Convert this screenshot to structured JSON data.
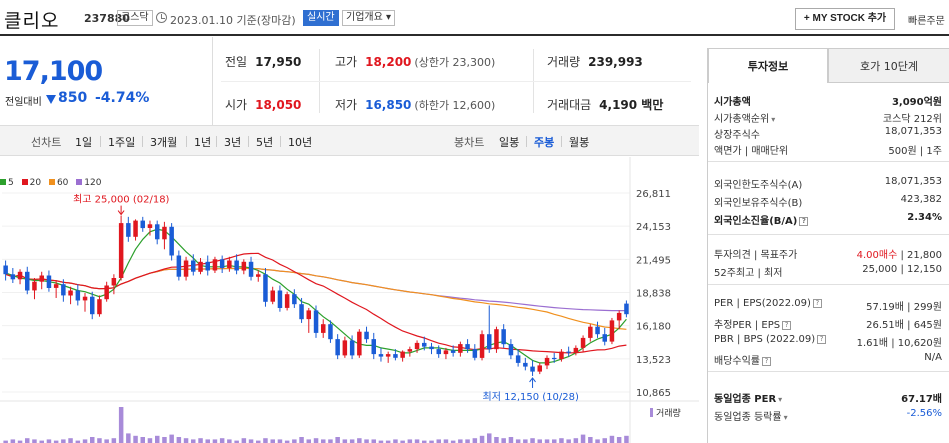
{
  "header": {
    "stock_name": "클리오",
    "stock_code": "237880",
    "market": "코스닥",
    "date_text": "2023.01.10 기준(장마감)",
    "live_label": "실시간",
    "corp_label": "기업개요",
    "corp_caret": "▾",
    "mystock_label": "+ MY STOCK 추가",
    "quick_label": "빠른주문"
  },
  "price": {
    "current": "17,100",
    "compare_label": "전일대비",
    "change": "850",
    "change_rate": "-4.74%"
  },
  "quote": {
    "prev_label": "전일",
    "prev": "17,950",
    "high_label": "고가",
    "high": "18,200",
    "upper_limit": "(상한가 23,300)",
    "volume_label": "거래량",
    "volume": "239,993",
    "open_label": "시가",
    "open": "18,050",
    "low_label": "저가",
    "low": "16,850",
    "lower_limit": "(하한가 12,600)",
    "amount_label": "거래대금",
    "amount": "4,190 백만"
  },
  "tabs": {
    "line_label": "선차트",
    "line_items": [
      "1일",
      "1주일",
      "3개월",
      "1년",
      "3년",
      "5년",
      "10년"
    ],
    "candle_label": "봉차트",
    "candle_items": [
      "일봉",
      "주봉",
      "월봉"
    ],
    "active": "주봉"
  },
  "chart_data": {
    "type": "candlestick",
    "period": "weekly",
    "moving_averages": [
      {
        "name": "5",
        "color": "#2ca02c"
      },
      {
        "name": "20",
        "color": "#e0171f"
      },
      {
        "name": "60",
        "color": "#f0901e"
      },
      {
        "name": "120",
        "color": "#9b6fd1"
      }
    ],
    "y_ticks": [
      "26,811",
      "24,153",
      "21,495",
      "18,838",
      "16,180",
      "13,523",
      "10,865"
    ],
    "ylim": [
      10865,
      26811
    ],
    "max_annotation": "최고 25,000 (02/18)",
    "min_annotation": "최저 12,150 (10/28)",
    "volume_label": "거래량",
    "candles": [
      [
        21000,
        21400,
        19800,
        20300
      ],
      [
        20300,
        20800,
        19600,
        19900
      ],
      [
        19900,
        20700,
        19500,
        20500
      ],
      [
        20500,
        20900,
        18700,
        19000
      ],
      [
        19000,
        20000,
        18300,
        19700
      ],
      [
        19700,
        20500,
        19100,
        20200
      ],
      [
        20200,
        20600,
        18900,
        19200
      ],
      [
        19200,
        19800,
        18400,
        19500
      ],
      [
        19500,
        19900,
        18100,
        18600
      ],
      [
        18600,
        19300,
        17900,
        19000
      ],
      [
        19000,
        19500,
        17800,
        18200
      ],
      [
        18200,
        18800,
        17300,
        18500
      ],
      [
        18500,
        18900,
        16700,
        17100
      ],
      [
        17100,
        18600,
        16900,
        18300
      ],
      [
        18300,
        19700,
        18100,
        19400
      ],
      [
        19400,
        20300,
        18700,
        20000
      ],
      [
        20000,
        25000,
        19800,
        24400
      ],
      [
        24400,
        24900,
        22900,
        23300
      ],
      [
        23300,
        24700,
        23000,
        24600
      ],
      [
        24600,
        24900,
        23700,
        24000
      ],
      [
        24000,
        24600,
        23400,
        24300
      ],
      [
        24300,
        24600,
        22700,
        23100
      ],
      [
        23100,
        24500,
        22300,
        24100
      ],
      [
        24100,
        24400,
        21400,
        21800
      ],
      [
        21800,
        22200,
        19800,
        20100
      ],
      [
        20100,
        21700,
        19800,
        21400
      ],
      [
        21400,
        21900,
        20200,
        20500
      ],
      [
        20500,
        21600,
        20300,
        21300
      ],
      [
        21300,
        21800,
        20200,
        20600
      ],
      [
        20600,
        21700,
        20400,
        21500
      ],
      [
        21500,
        21800,
        20400,
        20800
      ],
      [
        20800,
        21700,
        20500,
        21400
      ],
      [
        21400,
        21900,
        20300,
        20600
      ],
      [
        20600,
        21500,
        20300,
        21300
      ],
      [
        21300,
        21700,
        19800,
        20100
      ],
      [
        20100,
        20600,
        19700,
        20300
      ],
      [
        20300,
        20800,
        17700,
        18100
      ],
      [
        18100,
        19300,
        17900,
        19000
      ],
      [
        19000,
        19400,
        17300,
        17600
      ],
      [
        17600,
        18900,
        17400,
        18700
      ],
      [
        18700,
        19100,
        17600,
        17900
      ],
      [
        17900,
        18400,
        16400,
        16700
      ],
      [
        16700,
        17600,
        15600,
        17400
      ],
      [
        17400,
        17800,
        15200,
        15600
      ],
      [
        15600,
        16700,
        15200,
        16300
      ],
      [
        16300,
        16600,
        14800,
        15100
      ],
      [
        15100,
        15500,
        13500,
        13800
      ],
      [
        13800,
        15300,
        13600,
        15000
      ],
      [
        15000,
        15400,
        13500,
        13800
      ],
      [
        13800,
        15900,
        13600,
        15700
      ],
      [
        15700,
        16100,
        14800,
        15100
      ],
      [
        15100,
        15600,
        13500,
        13900
      ],
      [
        13900,
        14400,
        13300,
        13700
      ],
      [
        13700,
        14100,
        13200,
        13900
      ],
      [
        13900,
        14300,
        13400,
        13600
      ],
      [
        13600,
        14200,
        13300,
        14100
      ],
      [
        14100,
        14500,
        13700,
        14300
      ],
      [
        14300,
        15000,
        14000,
        14800
      ],
      [
        14800,
        15300,
        14200,
        14500
      ],
      [
        14500,
        14800,
        13900,
        14300
      ],
      [
        14300,
        14600,
        13600,
        13900
      ],
      [
        13900,
        14400,
        13500,
        14200
      ],
      [
        14200,
        14600,
        13700,
        14000
      ],
      [
        14000,
        14900,
        13700,
        14700
      ],
      [
        14700,
        15100,
        14000,
        14300
      ],
      [
        14300,
        14700,
        13400,
        13600
      ],
      [
        13600,
        15800,
        13400,
        15500
      ],
      [
        15500,
        17800,
        14000,
        14300
      ],
      [
        14300,
        16100,
        14000,
        15900
      ],
      [
        15900,
        16300,
        14400,
        14700
      ],
      [
        14700,
        15100,
        13500,
        13800
      ],
      [
        13800,
        14300,
        12900,
        13200
      ],
      [
        13200,
        13600,
        12600,
        12900
      ],
      [
        12900,
        13400,
        12150,
        12500
      ],
      [
        12500,
        13200,
        12300,
        13000
      ],
      [
        13000,
        13800,
        12700,
        13600
      ],
      [
        13600,
        14000,
        13200,
        13500
      ],
      [
        13500,
        14300,
        13300,
        14100
      ],
      [
        14100,
        14500,
        13700,
        14000
      ],
      [
        14000,
        14600,
        13800,
        14400
      ],
      [
        14400,
        15400,
        14100,
        15200
      ],
      [
        15200,
        16300,
        14900,
        16100
      ],
      [
        16100,
        16500,
        15200,
        15500
      ],
      [
        15500,
        16000,
        14600,
        14900
      ],
      [
        14900,
        16800,
        14700,
        16600
      ],
      [
        16600,
        17400,
        15900,
        17200
      ],
      [
        17950,
        18200,
        16850,
        17100
      ]
    ],
    "ma5": [
      20400,
      20200,
      20000,
      19900,
      19800,
      19800,
      19700,
      19600,
      19400,
      19200,
      19000,
      18900,
      18700,
      18500,
      18700,
      19100,
      20000,
      21200,
      22300,
      23100,
      23700,
      23900,
      23800,
      23300,
      22700,
      22100,
      21600,
      21000,
      20900,
      20900,
      20900,
      21000,
      20900,
      20900,
      20800,
      20600,
      20300,
      19900,
      19600,
      19100,
      18700,
      18100,
      17900,
      17400,
      16900,
      16500,
      16000,
      15500,
      15000,
      14700,
      14600,
      14600,
      14400,
      14300,
      14200,
      14000,
      14000,
      14200,
      14400,
      14400,
      14400,
      14300,
      14200,
      14200,
      14200,
      14200,
      14300,
      14600,
      14800,
      14900,
      14600,
      14200,
      13800,
      13400,
      13200,
      13200,
      13300,
      13500,
      13700,
      14000,
      14400,
      14800,
      15100,
      15300,
      15500,
      16000,
      16700
    ]
  },
  "info_tabs": [
    "투자정보",
    "호가 10단계"
  ],
  "info": [
    {
      "k": "시가총액",
      "v": "3,090억원",
      "bold": true
    },
    {
      "k": "시가총액순위",
      "v": "코스닥 212위",
      "caret": true
    },
    {
      "k": "상장주식수",
      "v": "18,071,353"
    },
    {
      "k": "액면가 | 매매단위",
      "v": "500원 | 1주"
    },
    {
      "k": "외국인한도주식수(A)",
      "v": "18,071,353"
    },
    {
      "k": "외국인보유주식수(B)",
      "v": "423,382"
    },
    {
      "k": "외국인소진율(B/A)",
      "v": "2.34%",
      "bold": true,
      "ibox": true
    },
    {
      "k": "투자의견 | 목표주가",
      "v_red": "4.00매수",
      "v": " | 21,800"
    },
    {
      "k": "52주최고 | 최저",
      "v": "25,000 | 12,150"
    },
    {
      "k": "PER | EPS(2022.09)",
      "v": "57.19배 | 299원",
      "ibox": true
    },
    {
      "k": "추정PER | EPS",
      "v": "26.51배 | 645원",
      "ibox": true
    },
    {
      "k": "PBR | BPS (2022.09)",
      "v": "1.61배 | 10,620원",
      "ibox": true
    },
    {
      "k": "배당수익률",
      "v": "N/A",
      "ibox": true
    },
    {
      "k": "동일업종 PER",
      "v": "67.17배",
      "bold": true,
      "caret": true
    },
    {
      "k": "동일업종 등락률",
      "v_blue": "-2.56%",
      "caret": true
    }
  ],
  "colors": {
    "up": "#e0171f",
    "down": "#1a5cd6",
    "vol": "#a88bd9"
  }
}
